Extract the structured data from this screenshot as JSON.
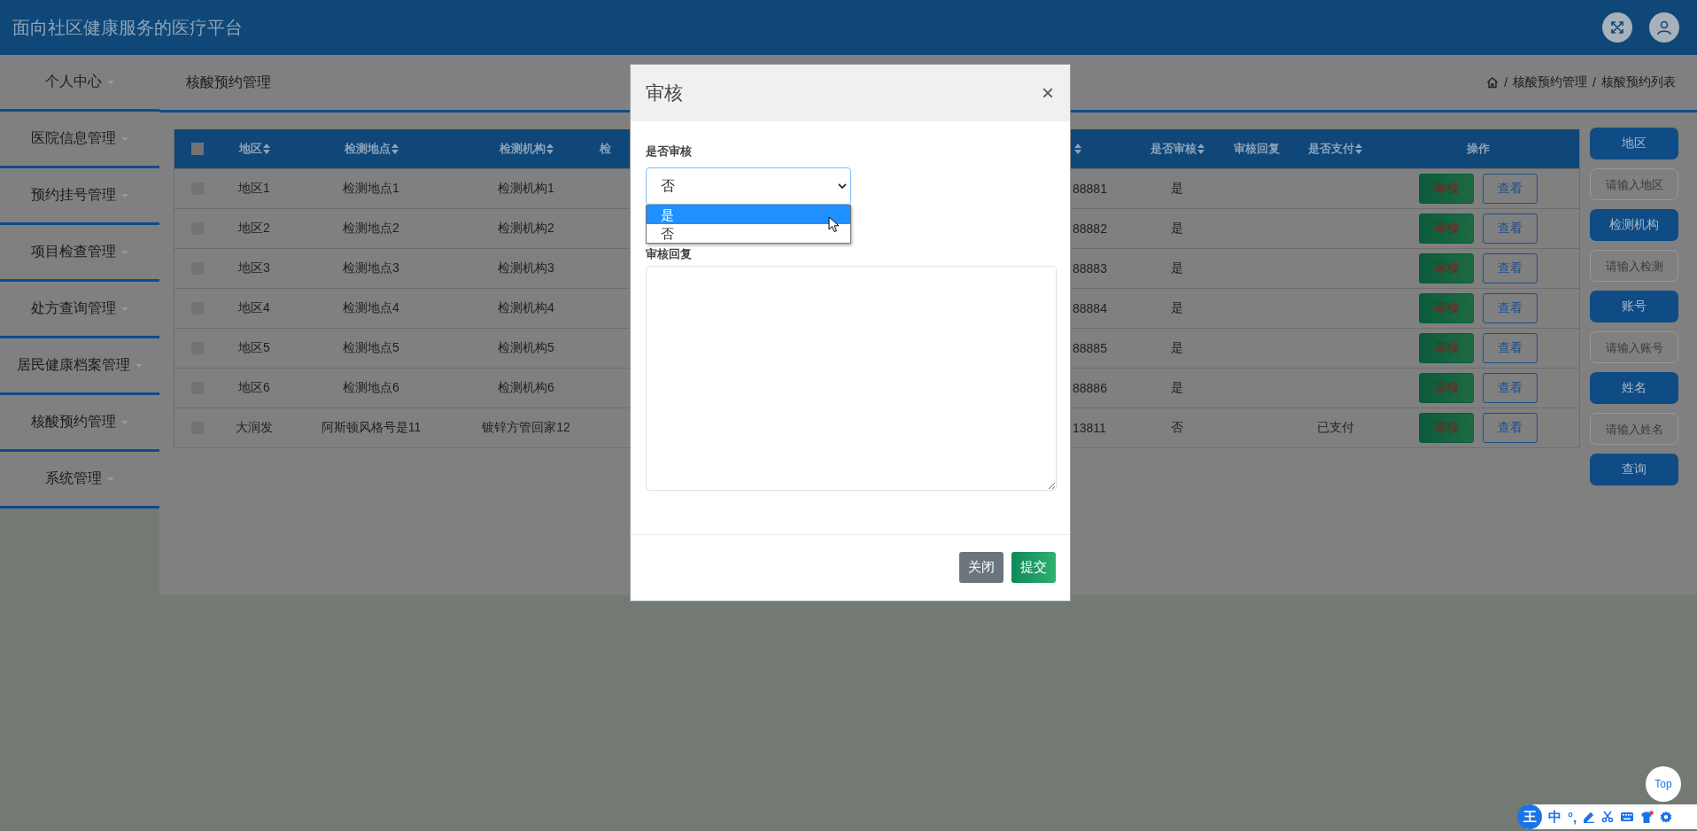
{
  "header": {
    "title": "面向社区健康服务的医疗平台"
  },
  "sidebar": {
    "items": [
      {
        "label": "个人中心"
      },
      {
        "label": "医院信息管理"
      },
      {
        "label": "预约挂号管理"
      },
      {
        "label": "项目检查管理"
      },
      {
        "label": "处方查询管理"
      },
      {
        "label": "居民健康档案管理"
      },
      {
        "label": "核酸预约管理"
      },
      {
        "label": "系统管理"
      }
    ]
  },
  "page_title": "核酸预约管理",
  "breadcrumb": [
    {
      "separator": "/",
      "label": "核酸预约管理"
    },
    {
      "separator": "/",
      "label": "核酸预约列表"
    }
  ],
  "table": {
    "select_all": {
      "checked": false
    },
    "columns": [
      {
        "label": "地区",
        "sortable": true
      },
      {
        "label": "检测地点",
        "sortable": true
      },
      {
        "label": "检测机构",
        "sortable": true
      },
      {
        "label": "检"
      },
      {
        "sortable": true
      },
      {
        "label": "是否审核",
        "sortable": true
      },
      {
        "label": "审核回复",
        "sortable": false
      },
      {
        "label": "是否支付",
        "sortable": true
      },
      {
        "label": "操作",
        "sortable": false
      }
    ],
    "rows": [
      {
        "checked": false,
        "region": "地区1",
        "site": "检测地点1",
        "org": "检测机构1",
        "column_5": "88881",
        "audited": "是",
        "actions": [
          "审核",
          "查看"
        ]
      },
      {
        "checked": false,
        "region": "地区2",
        "site": "检测地点2",
        "org": "检测机构2",
        "column_5": "88882",
        "audited": "是",
        "actions": [
          "审核",
          "查看"
        ]
      },
      {
        "checked": false,
        "region": "地区3",
        "site": "检测地点3",
        "org": "检测机构3",
        "column_5": "88883",
        "audited": "是",
        "actions": [
          "审核",
          "查看"
        ]
      },
      {
        "checked": false,
        "region": "地区4",
        "site": "检测地点4",
        "org": "检测机构4",
        "column_5": "88884",
        "audited": "是",
        "actions": [
          "审核",
          "查看"
        ]
      },
      {
        "checked": false,
        "region": "地区5",
        "site": "检测地点5",
        "org": "检测机构5",
        "column_5": "88885",
        "audited": "是",
        "actions": [
          "审核",
          "查看"
        ]
      },
      {
        "checked": false,
        "region": "地区6",
        "site": "检测地点6",
        "org": "检测机构6",
        "column_5": "88886",
        "audited": "是",
        "actions": [
          "审核",
          "查看"
        ]
      },
      {
        "checked": false,
        "region": "大润发",
        "site": "阿斯顿风格号是11",
        "org": "镀锌方管回家12",
        "column_5": "13811",
        "audited": "否",
        "paid": "已支付",
        "actions": [
          "审核",
          "查看"
        ]
      }
    ]
  },
  "search_panel": [
    {
      "kind": "label",
      "text": "地区"
    },
    {
      "kind": "input",
      "placeholder": "请输入地区"
    },
    {
      "kind": "label",
      "text": "检测机构"
    },
    {
      "kind": "input",
      "placeholder": "请输入检测"
    },
    {
      "kind": "label",
      "text": "账号"
    },
    {
      "kind": "input",
      "placeholder": "请输入账号"
    },
    {
      "kind": "label",
      "text": "姓名"
    },
    {
      "kind": "input",
      "placeholder": "请输入姓名"
    },
    {
      "kind": "button",
      "text": "查询"
    }
  ],
  "modal": {
    "title": "审核",
    "close": "×",
    "audit_select": {
      "label": "是否审核",
      "value": "否",
      "expanded": true,
      "options": [
        {
          "label": "是",
          "highlighted": true
        },
        {
          "label": "否",
          "highlighted": false
        }
      ]
    },
    "reply": {
      "label": "审核回复"
    },
    "buttons": [
      {
        "kind": "secondary",
        "label": "关闭"
      },
      {
        "kind": "primary",
        "label": "提交"
      }
    ]
  },
  "top_button": "Top",
  "ime_toolbar": {
    "logo": "王",
    "mode": "中",
    "punctuation": "°,"
  }
}
